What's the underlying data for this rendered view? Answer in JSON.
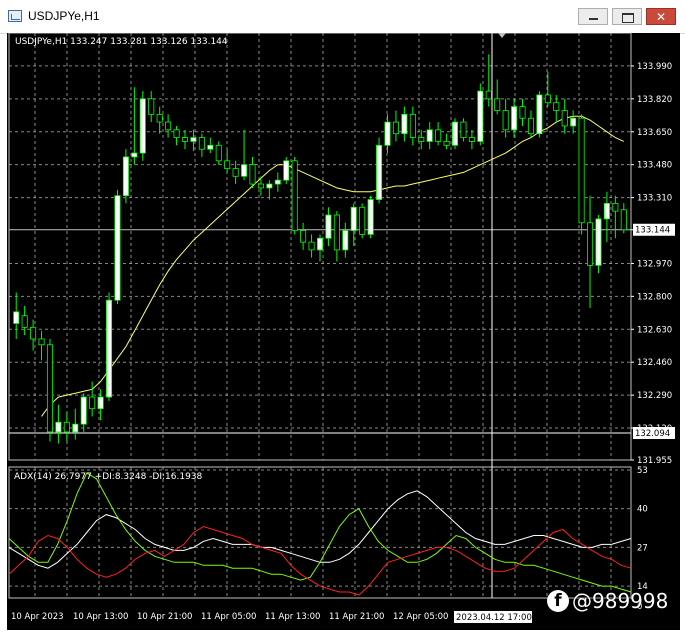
{
  "window": {
    "title": "USDJPYe,H1",
    "controls": {
      "minimize_icon": "minimize-icon",
      "maximize_icon": "maximize-icon",
      "close_icon": "close-icon"
    }
  },
  "chart": {
    "header": "USDJPYe,H1  133.247 133.281 133.126 133.144",
    "current_price_label": "133.144",
    "crosshair_price_label": "132.094",
    "crosshair_time_label": "2023.04.12 17:00",
    "colors": {
      "background": "#000000",
      "bull": "#ffffff",
      "bear": "#000000",
      "wick": "#00ff00",
      "ma": "#ffff66",
      "grid": "#c0c0c0",
      "adx": "#ffffff",
      "plus_di": "#7cfc00",
      "minus_di": "#ff2020"
    },
    "indicator_header": "ADX(14) 26.7977 +DI:8.3248 -DI:16.1938"
  },
  "chart_data": [
    {
      "type": "candlestick",
      "symbol": "USDJPYe",
      "timeframe": "H1",
      "ylim": [
        131.955,
        134.16
      ],
      "price_ticks": [
        "133.990",
        "133.820",
        "133.650",
        "133.480",
        "133.310",
        "133.144",
        "132.970",
        "132.800",
        "132.630",
        "132.460",
        "132.290",
        "132.120",
        "131.955"
      ],
      "time_ticks": [
        "10 Apr 2023",
        "10 Apr 13:00",
        "10 Apr 21:00",
        "11 Apr 05:00",
        "11 Apr 13:00",
        "11 Apr 21:00",
        "12 Apr 05:00"
      ],
      "candles": [
        {
          "o": 132.66,
          "h": 132.82,
          "l": 132.58,
          "c": 132.72
        },
        {
          "o": 132.7,
          "h": 132.75,
          "l": 132.6,
          "c": 132.64
        },
        {
          "o": 132.64,
          "h": 132.68,
          "l": 132.52,
          "c": 132.58
        },
        {
          "o": 132.58,
          "h": 132.62,
          "l": 132.47,
          "c": 132.55
        },
        {
          "o": 132.55,
          "h": 132.58,
          "l": 132.05,
          "c": 132.1
        },
        {
          "o": 132.1,
          "h": 132.24,
          "l": 132.04,
          "c": 132.15
        },
        {
          "o": 132.15,
          "h": 132.2,
          "l": 132.05,
          "c": 132.1
        },
        {
          "o": 132.1,
          "h": 132.22,
          "l": 132.06,
          "c": 132.14
        },
        {
          "o": 132.14,
          "h": 132.3,
          "l": 132.1,
          "c": 132.28
        },
        {
          "o": 132.28,
          "h": 132.36,
          "l": 132.18,
          "c": 132.22
        },
        {
          "o": 132.22,
          "h": 132.32,
          "l": 132.16,
          "c": 132.28
        },
        {
          "o": 132.28,
          "h": 132.82,
          "l": 132.26,
          "c": 132.78
        },
        {
          "o": 132.78,
          "h": 133.35,
          "l": 132.76,
          "c": 133.32
        },
        {
          "o": 133.32,
          "h": 133.56,
          "l": 133.28,
          "c": 133.52
        },
        {
          "o": 133.52,
          "h": 133.88,
          "l": 133.48,
          "c": 133.54
        },
        {
          "o": 133.54,
          "h": 133.86,
          "l": 133.5,
          "c": 133.82
        },
        {
          "o": 133.82,
          "h": 133.86,
          "l": 133.7,
          "c": 133.74
        },
        {
          "o": 133.74,
          "h": 133.78,
          "l": 133.64,
          "c": 133.7
        },
        {
          "o": 133.7,
          "h": 133.74,
          "l": 133.62,
          "c": 133.66
        },
        {
          "o": 133.66,
          "h": 133.68,
          "l": 133.58,
          "c": 133.62
        },
        {
          "o": 133.62,
          "h": 133.66,
          "l": 133.56,
          "c": 133.6
        },
        {
          "o": 133.6,
          "h": 133.66,
          "l": 133.55,
          "c": 133.62
        },
        {
          "o": 133.62,
          "h": 133.64,
          "l": 133.52,
          "c": 133.56
        },
        {
          "o": 133.56,
          "h": 133.62,
          "l": 133.54,
          "c": 133.58
        },
        {
          "o": 133.58,
          "h": 133.6,
          "l": 133.48,
          "c": 133.5
        },
        {
          "o": 133.5,
          "h": 133.56,
          "l": 133.44,
          "c": 133.46
        },
        {
          "o": 133.46,
          "h": 133.5,
          "l": 133.38,
          "c": 133.42
        },
        {
          "o": 133.42,
          "h": 133.66,
          "l": 133.4,
          "c": 133.48
        },
        {
          "o": 133.48,
          "h": 133.52,
          "l": 133.36,
          "c": 133.38
        },
        {
          "o": 133.38,
          "h": 133.42,
          "l": 133.32,
          "c": 133.36
        },
        {
          "o": 133.36,
          "h": 133.4,
          "l": 133.3,
          "c": 133.38
        },
        {
          "o": 133.38,
          "h": 133.44,
          "l": 133.34,
          "c": 133.4
        },
        {
          "o": 133.4,
          "h": 133.52,
          "l": 133.38,
          "c": 133.5
        },
        {
          "o": 133.5,
          "h": 133.52,
          "l": 133.12,
          "c": 133.14
        },
        {
          "o": 133.14,
          "h": 133.18,
          "l": 133.04,
          "c": 133.08
        },
        {
          "o": 133.08,
          "h": 133.12,
          "l": 133.0,
          "c": 133.04
        },
        {
          "o": 133.04,
          "h": 133.12,
          "l": 132.98,
          "c": 133.1
        },
        {
          "o": 133.1,
          "h": 133.26,
          "l": 133.06,
          "c": 133.22
        },
        {
          "o": 133.22,
          "h": 133.24,
          "l": 132.98,
          "c": 133.04
        },
        {
          "o": 133.04,
          "h": 133.18,
          "l": 133.0,
          "c": 133.14
        },
        {
          "o": 133.14,
          "h": 133.28,
          "l": 133.06,
          "c": 133.26
        },
        {
          "o": 133.26,
          "h": 133.28,
          "l": 133.1,
          "c": 133.12
        },
        {
          "o": 133.12,
          "h": 133.32,
          "l": 133.1,
          "c": 133.3
        },
        {
          "o": 133.3,
          "h": 133.62,
          "l": 133.28,
          "c": 133.58
        },
        {
          "o": 133.58,
          "h": 133.74,
          "l": 133.54,
          "c": 133.7
        },
        {
          "o": 133.7,
          "h": 133.76,
          "l": 133.6,
          "c": 133.64
        },
        {
          "o": 133.64,
          "h": 133.78,
          "l": 133.6,
          "c": 133.74
        },
        {
          "o": 133.74,
          "h": 133.78,
          "l": 133.58,
          "c": 133.62
        },
        {
          "o": 133.62,
          "h": 133.66,
          "l": 133.56,
          "c": 133.6
        },
        {
          "o": 133.6,
          "h": 133.7,
          "l": 133.56,
          "c": 133.66
        },
        {
          "o": 133.66,
          "h": 133.7,
          "l": 133.58,
          "c": 133.6
        },
        {
          "o": 133.6,
          "h": 133.64,
          "l": 133.56,
          "c": 133.58
        },
        {
          "o": 133.58,
          "h": 133.72,
          "l": 133.56,
          "c": 133.7
        },
        {
          "o": 133.7,
          "h": 133.72,
          "l": 133.6,
          "c": 133.62
        },
        {
          "o": 133.62,
          "h": 133.66,
          "l": 133.56,
          "c": 133.6
        },
        {
          "o": 133.6,
          "h": 133.9,
          "l": 133.58,
          "c": 133.86
        },
        {
          "o": 133.86,
          "h": 134.05,
          "l": 133.78,
          "c": 133.82
        },
        {
          "o": 133.82,
          "h": 133.92,
          "l": 133.74,
          "c": 133.76
        },
        {
          "o": 133.76,
          "h": 133.82,
          "l": 133.62,
          "c": 133.66
        },
        {
          "o": 133.66,
          "h": 133.82,
          "l": 133.62,
          "c": 133.78
        },
        {
          "o": 133.78,
          "h": 133.82,
          "l": 133.68,
          "c": 133.72
        },
        {
          "o": 133.72,
          "h": 133.76,
          "l": 133.62,
          "c": 133.64
        },
        {
          "o": 133.64,
          "h": 133.86,
          "l": 133.62,
          "c": 133.84
        },
        {
          "o": 133.84,
          "h": 133.96,
          "l": 133.78,
          "c": 133.8
        },
        {
          "o": 133.8,
          "h": 133.84,
          "l": 133.7,
          "c": 133.76
        },
        {
          "o": 133.76,
          "h": 133.82,
          "l": 133.64,
          "c": 133.68
        },
        {
          "o": 133.68,
          "h": 133.76,
          "l": 133.64,
          "c": 133.72
        },
        {
          "o": 133.72,
          "h": 133.74,
          "l": 133.12,
          "c": 133.18
        },
        {
          "o": 133.18,
          "h": 133.32,
          "l": 132.74,
          "c": 132.96
        },
        {
          "o": 132.96,
          "h": 133.22,
          "l": 132.92,
          "c": 133.2
        },
        {
          "o": 133.2,
          "h": 133.34,
          "l": 133.08,
          "c": 133.28
        },
        {
          "o": 133.28,
          "h": 133.32,
          "l": 133.1,
          "c": 133.24
        },
        {
          "o": 133.247,
          "h": 133.281,
          "l": 133.126,
          "c": 133.144
        }
      ],
      "moving_average": [
        132.18,
        132.24,
        132.28,
        132.29,
        132.3,
        132.31,
        132.32,
        132.36,
        132.42,
        132.48,
        132.54,
        132.62,
        132.7,
        132.78,
        132.86,
        132.93,
        132.99,
        133.04,
        133.09,
        133.13,
        133.17,
        133.21,
        133.25,
        133.29,
        133.33,
        133.37,
        133.41,
        133.45,
        133.48,
        133.48,
        133.46,
        133.44,
        133.42,
        133.4,
        133.38,
        133.36,
        133.35,
        133.34,
        133.34,
        133.34,
        133.35,
        133.36,
        133.37,
        133.37,
        133.38,
        133.39,
        133.4,
        133.41,
        133.42,
        133.43,
        133.44,
        133.46,
        133.48,
        133.5,
        133.52,
        133.54,
        133.57,
        133.6,
        133.62,
        133.65,
        133.67,
        133.7,
        133.72,
        133.73,
        133.73,
        133.71,
        133.68,
        133.65,
        133.62,
        133.6
      ],
      "ma_offset": 3
    },
    {
      "type": "line",
      "title": "ADX(14) 26.7977 +DI:8.3248 -DI:16.1938",
      "ylim": [
        10,
        54
      ],
      "y_ticks": [
        "53",
        "40",
        "27",
        "14",
        "0"
      ],
      "series": [
        {
          "name": "ADX",
          "values": [
            27,
            25,
            23,
            21,
            20,
            22,
            25,
            28,
            32,
            36,
            38,
            37,
            35,
            33,
            30,
            28,
            27,
            26,
            26,
            27,
            29,
            30,
            29,
            28,
            28,
            28,
            27,
            27,
            26,
            25,
            24,
            23,
            22,
            22,
            23,
            25,
            28,
            32,
            36,
            40,
            43,
            45,
            46,
            44,
            41,
            38,
            35,
            32,
            30,
            29,
            28,
            28,
            29,
            30,
            31,
            31,
            30,
            29,
            28,
            27,
            27,
            28,
            28,
            29,
            30
          ]
        },
        {
          "name": "+DI",
          "values": [
            30,
            27,
            24,
            22,
            22,
            28,
            36,
            45,
            52,
            50,
            44,
            38,
            33,
            29,
            26,
            24,
            23,
            22,
            22,
            22,
            21,
            21,
            21,
            20,
            20,
            20,
            19,
            18,
            18,
            17,
            16,
            17,
            22,
            28,
            34,
            38,
            40,
            34,
            29,
            26,
            24,
            22,
            22,
            23,
            25,
            28,
            31,
            30,
            27,
            25,
            23,
            22,
            22,
            21,
            21,
            20,
            19,
            18,
            17,
            16,
            15,
            14,
            14,
            13,
            12
          ]
        },
        {
          "name": "-DI",
          "values": [
            18,
            21,
            24,
            29,
            31,
            30,
            27,
            23,
            20,
            18,
            17,
            18,
            20,
            23,
            25,
            26,
            24,
            26,
            28,
            32,
            34,
            33,
            32,
            31,
            30,
            28,
            27,
            26,
            25,
            21,
            18,
            16,
            14,
            13,
            12,
            12,
            11,
            14,
            18,
            22,
            23,
            24,
            25,
            26,
            27,
            27,
            26,
            24,
            22,
            20,
            19,
            19,
            20,
            23,
            26,
            29,
            32,
            33,
            30,
            28,
            26,
            24,
            23,
            21,
            20
          ]
        }
      ]
    }
  ]
}
